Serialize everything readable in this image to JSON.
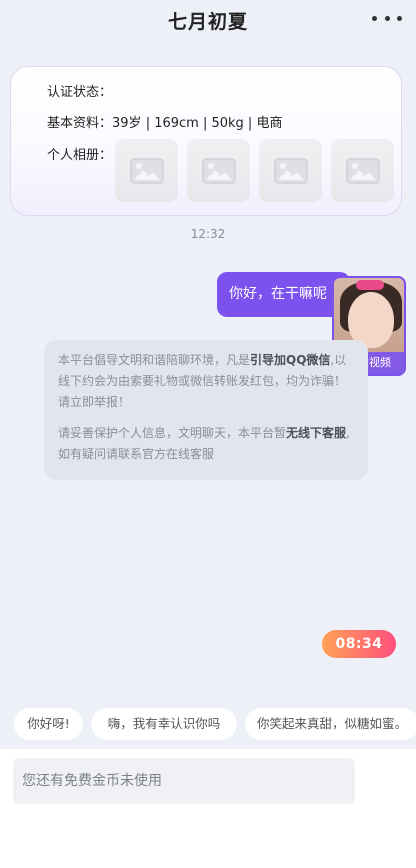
{
  "header": {
    "title": "七月初夏",
    "more_icon": "more-dots-icon"
  },
  "profile": {
    "auth_label": "认证状态：",
    "auth_value": "",
    "basic_label": "基本资料：",
    "basic_value": "39岁 | 169cm | 50kg | 电商",
    "album_label": "个人相册：",
    "photo_icon": "image-placeholder-icon"
  },
  "chat": {
    "timestamp": "12:32",
    "my_message": "你好，在干嘛呢",
    "video_caption": "免费视频",
    "notice": {
      "p1_a": "本平台倡导文明和谐陪聊环境，凡是",
      "p1_b": "引导加QQ微信",
      "p1_c": ",以线下约会为由索要礼物或微信转账发红包，均为诈骗！请立即举报！",
      "p2_a": "请妥善保护个人信息，文明聊天，本平台暂",
      "p2_b": "无线下客服",
      "p2_c": ",如有疑问请联系官方在线客服"
    },
    "call_timer": "08:34"
  },
  "quick_replies": [
    "你好呀!",
    "嗨，我有幸认识你吗",
    "你笑起来真甜，似糖如蜜。"
  ],
  "input": {
    "placeholder": "您还有免费金币未使用",
    "value": ""
  },
  "colors": {
    "accent": "#7b52ee",
    "timer_gradient_start": "#ffa255",
    "timer_gradient_end": "#ff4f7c",
    "background": "#eef0f7"
  }
}
